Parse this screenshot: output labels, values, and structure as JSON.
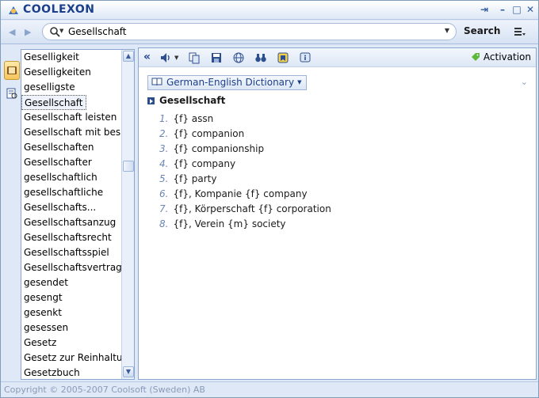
{
  "app": {
    "title": "COOLEXON"
  },
  "toolbar": {
    "search_value": "Gesellschaft",
    "search_label": "Search"
  },
  "wordlist": {
    "items": [
      "Geselligkeit",
      "Geselligkeiten",
      "geselligste",
      "Gesellschaft",
      "Gesellschaft leisten",
      "Gesellschaft mit bes...",
      "Gesellschaften",
      "Gesellschafter",
      "gesellschaftlich",
      "gesellschaftliche",
      "Gesellschafts...",
      "Gesellschaftsanzug",
      "Gesellschaftsrecht",
      "Gesellschaftsspiel",
      "Gesellschaftsvertrag",
      "gesendet",
      "gesengt",
      "gesenkt",
      "gesessen",
      "Gesetz",
      "Gesetz zur Reinhaltu...",
      "Gesetzbuch"
    ],
    "selected_index": 3
  },
  "panel": {
    "activation_label": "Activation",
    "dictionary": "German-English Dictionary",
    "headword": "Gesellschaft",
    "senses": [
      {
        "num": "1.",
        "text": "{f} assn"
      },
      {
        "num": "2.",
        "text": "{f} companion"
      },
      {
        "num": "3.",
        "text": "{f} companionship"
      },
      {
        "num": "4.",
        "text": "{f} company"
      },
      {
        "num": "5.",
        "text": "{f} party"
      },
      {
        "num": "6.",
        "text": "{f}, Kompanie {f} company"
      },
      {
        "num": "7.",
        "text": "{f}, Körperschaft {f} corporation"
      },
      {
        "num": "8.",
        "text": "{f}, Verein {m} society"
      }
    ]
  },
  "status": {
    "copyright": "Copyright © 2005-2007 Coolsoft (Sweden) AB"
  },
  "icons": {
    "titlebar": [
      "pin-icon",
      "minimize-icon",
      "maximize-icon",
      "close-icon"
    ],
    "panel_toolbar": [
      "collapse-icon",
      "speaker-icon",
      "copy-icon",
      "save-icon",
      "globe-icon",
      "binoculars-icon",
      "bookmark-icon",
      "info-icon",
      "tag-icon"
    ]
  },
  "colors": {
    "accent": "#1c3f8c",
    "sense_number": "#6b86b4",
    "frame": "#dfe8f6"
  }
}
